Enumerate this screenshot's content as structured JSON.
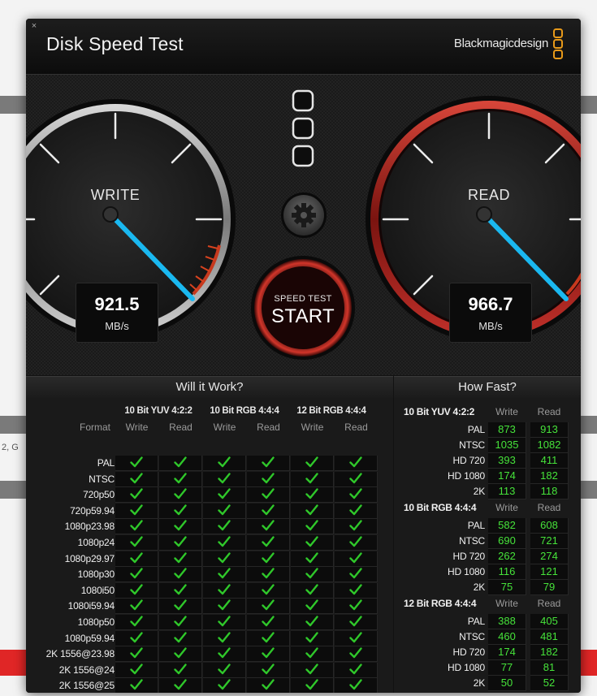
{
  "background": {
    "partial_text": "2, G"
  },
  "window": {
    "title": "Disk Speed Test",
    "brand": "Blackmagicdesign",
    "close_glyph": "×"
  },
  "gauges": {
    "write": {
      "label": "WRITE",
      "value": "921.5",
      "unit": "MB/s"
    },
    "read": {
      "label": "READ",
      "value": "966.7",
      "unit": "MB/s"
    }
  },
  "start_button": {
    "small_label": "SPEED TEST",
    "big_label": "START"
  },
  "icons": {
    "settings": "gear-icon",
    "logo": "blackmagic-logo-icon",
    "check": "check-icon"
  },
  "colors": {
    "needle": "#1ab8f0",
    "red_ring": "#c0221a",
    "value_green": "#46e33a",
    "check_green": "#2fc72a"
  },
  "will_it_work": {
    "title": "Will it Work?",
    "format_label": "Format",
    "groups": [
      {
        "name": "10 Bit YUV 4:2:2",
        "write": "Write",
        "read": "Read"
      },
      {
        "name": "10 Bit RGB 4:4:4",
        "write": "Write",
        "read": "Read"
      },
      {
        "name": "12 Bit RGB 4:4:4",
        "write": "Write",
        "read": "Read"
      }
    ],
    "formats": [
      "PAL",
      "NTSC",
      "720p50",
      "720p59.94",
      "1080p23.98",
      "1080p24",
      "1080p29.97",
      "1080p30",
      "1080i50",
      "1080i59.94",
      "1080p50",
      "1080p59.94",
      "2K 1556@23.98",
      "2K 1556@24",
      "2K 1556@25"
    ],
    "all_supported": true
  },
  "how_fast": {
    "title": "How Fast?",
    "groups": [
      {
        "name": "10 Bit YUV 4:2:2",
        "write": "Write",
        "read": "Read",
        "rows": [
          {
            "label": "PAL",
            "write": "873",
            "read": "913"
          },
          {
            "label": "NTSC",
            "write": "1035",
            "read": "1082"
          },
          {
            "label": "HD 720",
            "write": "393",
            "read": "411"
          },
          {
            "label": "HD 1080",
            "write": "174",
            "read": "182"
          },
          {
            "label": "2K",
            "write": "113",
            "read": "118"
          }
        ]
      },
      {
        "name": "10 Bit RGB 4:4:4",
        "write": "Write",
        "read": "Read",
        "rows": [
          {
            "label": "PAL",
            "write": "582",
            "read": "608"
          },
          {
            "label": "NTSC",
            "write": "690",
            "read": "721"
          },
          {
            "label": "HD 720",
            "write": "262",
            "read": "274"
          },
          {
            "label": "HD 1080",
            "write": "116",
            "read": "121"
          },
          {
            "label": "2K",
            "write": "75",
            "read": "79"
          }
        ]
      },
      {
        "name": "12 Bit RGB 4:4:4",
        "write": "Write",
        "read": "Read",
        "rows": [
          {
            "label": "PAL",
            "write": "388",
            "read": "405"
          },
          {
            "label": "NTSC",
            "write": "460",
            "read": "481"
          },
          {
            "label": "HD 720",
            "write": "174",
            "read": "182"
          },
          {
            "label": "HD 1080",
            "write": "77",
            "read": "81"
          },
          {
            "label": "2K",
            "write": "50",
            "read": "52"
          }
        ]
      }
    ]
  }
}
